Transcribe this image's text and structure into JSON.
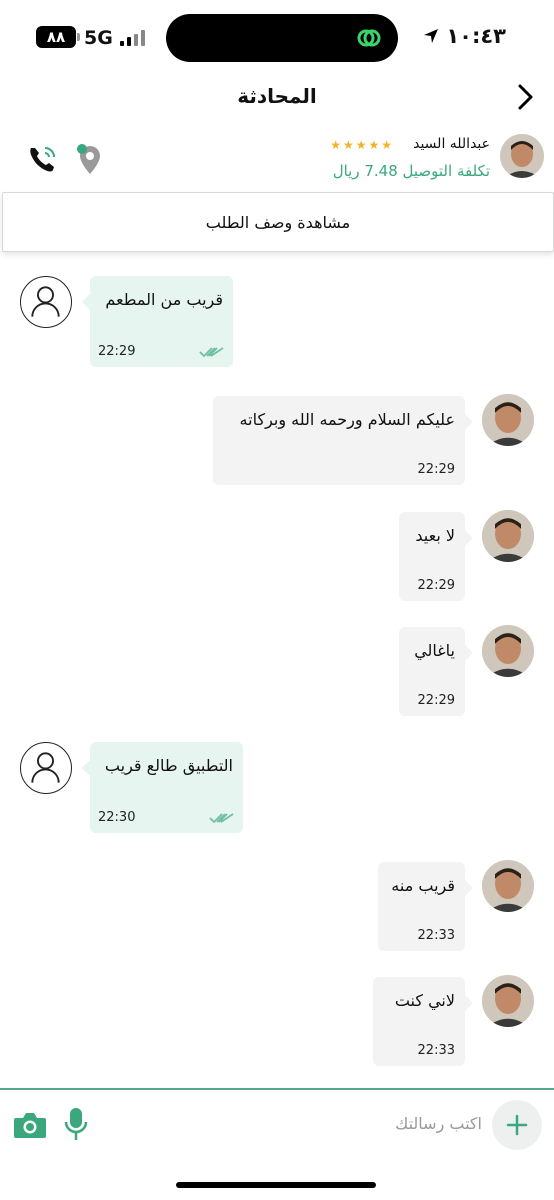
{
  "status_bar": {
    "time": "١٠:٤٣",
    "battery": "٨٨",
    "network": "5G"
  },
  "header": {
    "title": "المحادثة"
  },
  "driver": {
    "name": "عبدالله السيد",
    "stars": "★★★★★",
    "delivery_fee": "تكلفة التوصيل 7.48 ريال"
  },
  "order_button": {
    "label": "مشاهدة وصف الطلب"
  },
  "messages": [
    {
      "text": "قريب من المطعم",
      "time": "22:29"
    },
    {
      "text": "عليكم السلام ورحمه الله وبركاته",
      "time": "22:29"
    },
    {
      "text": "لا بعيد",
      "time": "22:29"
    },
    {
      "text": "ياغالي",
      "time": "22:29"
    },
    {
      "text": "التطبيق طالع قريب",
      "time": "22:30"
    },
    {
      "text": "قريب منه",
      "time": "22:33"
    },
    {
      "text": "لاني كنت",
      "time": "22:33"
    }
  ],
  "composer": {
    "placeholder": "اكتب رسالتك"
  },
  "colors": {
    "accent": "#3aa87c",
    "incoming_bubble": "#e6f5ef",
    "outgoing_bubble": "#f3f3f3",
    "star": "#f3b228"
  }
}
